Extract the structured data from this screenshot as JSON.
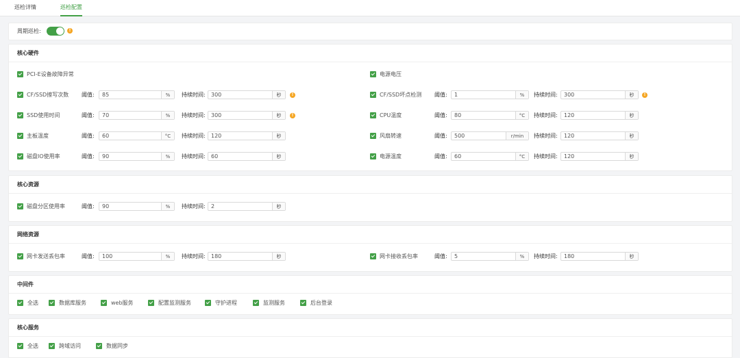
{
  "tabs": [
    {
      "label": "巡检详情",
      "active": false
    },
    {
      "label": "巡检配置",
      "active": true
    }
  ],
  "periodic": {
    "label": "周期巡检:",
    "enabled": true
  },
  "labels": {
    "threshold": "阈值:",
    "duration": "持续时间:"
  },
  "sections": {
    "core_hardware": {
      "title": "核心硬件",
      "left": [
        {
          "label": "PCI-E设备故障异常",
          "checked": true
        },
        {
          "label": "CF/SSD擦写次数",
          "checked": true,
          "threshold": "85",
          "unit": "%",
          "duration": "300",
          "duration_unit": "秒",
          "warn": true
        },
        {
          "label": "SSD使用时间",
          "checked": true,
          "threshold": "70",
          "unit": "%",
          "duration": "300",
          "duration_unit": "秒",
          "warn": true
        },
        {
          "label": "主板温度",
          "checked": true,
          "threshold": "60",
          "unit": "°C",
          "duration": "120",
          "duration_unit": "秒"
        },
        {
          "label": "磁盘IO使用率",
          "checked": true,
          "threshold": "90",
          "unit": "%",
          "duration": "60",
          "duration_unit": "秒"
        }
      ],
      "right": [
        {
          "label": "电源电压",
          "checked": true
        },
        {
          "label": "CF/SSD坏点检测",
          "checked": true,
          "threshold": "1",
          "unit": "%",
          "duration": "300",
          "duration_unit": "秒",
          "warn": true
        },
        {
          "label": "CPU温度",
          "checked": true,
          "threshold": "80",
          "unit": "°C",
          "duration": "120",
          "duration_unit": "秒"
        },
        {
          "label": "风扇转速",
          "checked": true,
          "threshold": "500",
          "unit": "r/min",
          "duration": "120",
          "duration_unit": "秒"
        },
        {
          "label": "电源温度",
          "checked": true,
          "threshold": "60",
          "unit": "°C",
          "duration": "120",
          "duration_unit": "秒"
        }
      ]
    },
    "core_resource": {
      "title": "核心资源",
      "left": [
        {
          "label": "磁盘分区使用率",
          "checked": true,
          "threshold": "90",
          "unit": "%",
          "duration": "2",
          "duration_unit": "秒"
        }
      ]
    },
    "network_resource": {
      "title": "网络资源",
      "left": [
        {
          "label": "网卡发送丢包率",
          "checked": true,
          "threshold": "100",
          "unit": "%",
          "duration": "180",
          "duration_unit": "秒"
        }
      ],
      "right": [
        {
          "label": "网卡接收丢包率",
          "checked": true,
          "threshold": "5",
          "unit": "%",
          "duration": "180",
          "duration_unit": "秒"
        }
      ]
    },
    "middleware": {
      "title": "中间件",
      "items": [
        "全选",
        "数据库服务",
        "web服务",
        "配置监测服务",
        "守护进程",
        "监测服务",
        "后台登录"
      ]
    },
    "core_service": {
      "title": "核心服务",
      "items": [
        "全选",
        "跨域访问",
        "数据同步"
      ]
    }
  },
  "colors": {
    "accent": "#43a047",
    "warn": "#f5a623"
  },
  "icons": {
    "warn": "exclamation-circle-icon",
    "check": "checkbox-checked-icon"
  }
}
